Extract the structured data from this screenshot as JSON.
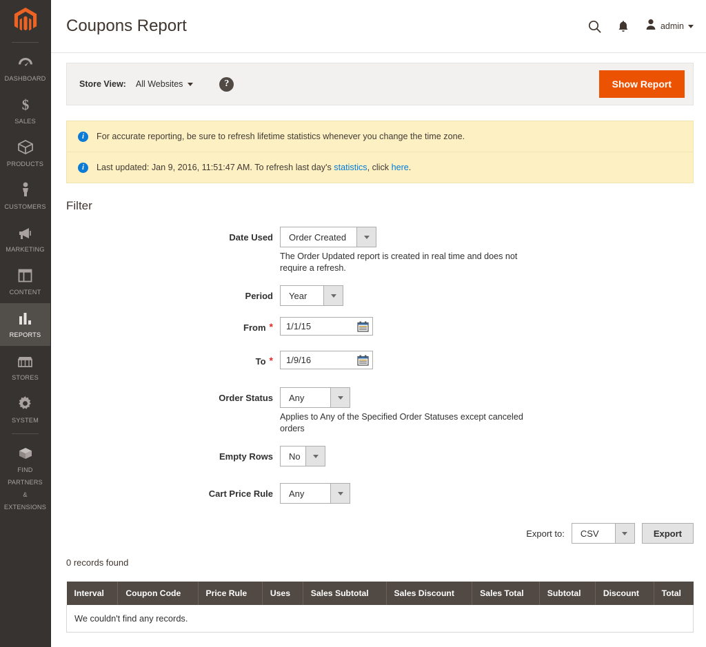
{
  "sidebar": {
    "logo_name": "magento-logo",
    "items": [
      {
        "label": "DASHBOARD",
        "icon": "dashboard-icon",
        "active": false
      },
      {
        "label": "SALES",
        "icon": "dollar-icon",
        "active": false
      },
      {
        "label": "PRODUCTS",
        "icon": "box-icon",
        "active": false
      },
      {
        "label": "CUSTOMERS",
        "icon": "person-icon",
        "active": false
      },
      {
        "label": "MARKETING",
        "icon": "megaphone-icon",
        "active": false
      },
      {
        "label": "CONTENT",
        "icon": "layout-icon",
        "active": false
      },
      {
        "label": "REPORTS",
        "icon": "bar-chart-icon",
        "active": true
      },
      {
        "label": "STORES",
        "icon": "store-icon",
        "active": false
      },
      {
        "label": "SYSTEM",
        "icon": "gear-icon",
        "active": false
      },
      {
        "label": "FIND PARTNERS\n& EXTENSIONS",
        "icon": "package-icon",
        "active": false
      }
    ]
  },
  "header": {
    "title": "Coupons Report",
    "search_icon": "search-icon",
    "notifications_icon": "bell-icon",
    "admin_label": "admin"
  },
  "storebar": {
    "store_view_label": "Store View:",
    "store_view_value": "All Websites",
    "help_icon": "question-mark-icon",
    "show_report_label": "Show Report"
  },
  "messages": [
    {
      "icon": "info-icon",
      "text": "For accurate reporting, be sure to refresh lifetime statistics whenever you change the time zone.",
      "parts": null
    },
    {
      "icon": "info-icon",
      "prefix": "Last updated: Jan 9, 2016, 11:51:47 AM. To refresh last day's ",
      "link1": "statistics",
      "middle": ", click ",
      "link2": "here",
      "suffix": "."
    }
  ],
  "filter": {
    "section_title": "Filter",
    "date_used": {
      "label": "Date Used",
      "value": "Order Created",
      "note": "The Order Updated report is created in real time and does not require a refresh."
    },
    "period": {
      "label": "Period",
      "value": "Year"
    },
    "from": {
      "label": "From",
      "value": "1/1/15",
      "required": "*",
      "calendar_icon": "calendar-icon"
    },
    "to": {
      "label": "To",
      "value": "1/9/16",
      "required": "*",
      "calendar_icon": "calendar-icon"
    },
    "order_status": {
      "label": "Order Status",
      "value": "Any",
      "note": "Applies to Any of the Specified Order Statuses except canceled orders"
    },
    "empty_rows": {
      "label": "Empty Rows",
      "value": "No"
    },
    "cart_price_rule": {
      "label": "Cart Price Rule",
      "value": "Any"
    }
  },
  "export": {
    "label": "Export to:",
    "format": "CSV",
    "button": "Export"
  },
  "results": {
    "records_found": "0 records found",
    "empty_message": "We couldn't find any records.",
    "columns": [
      "Interval",
      "Coupon Code",
      "Price Rule",
      "Uses",
      "Sales Subtotal",
      "Sales Discount",
      "Sales Total",
      "Subtotal",
      "Discount",
      "Total"
    ]
  },
  "colors": {
    "brand_orange": "#eb5202",
    "sidebar_bg": "#373330",
    "sidebar_active": "#524e4a",
    "message_bg": "#fdf0c3",
    "table_header": "#514943",
    "link_blue": "#007bdb"
  }
}
